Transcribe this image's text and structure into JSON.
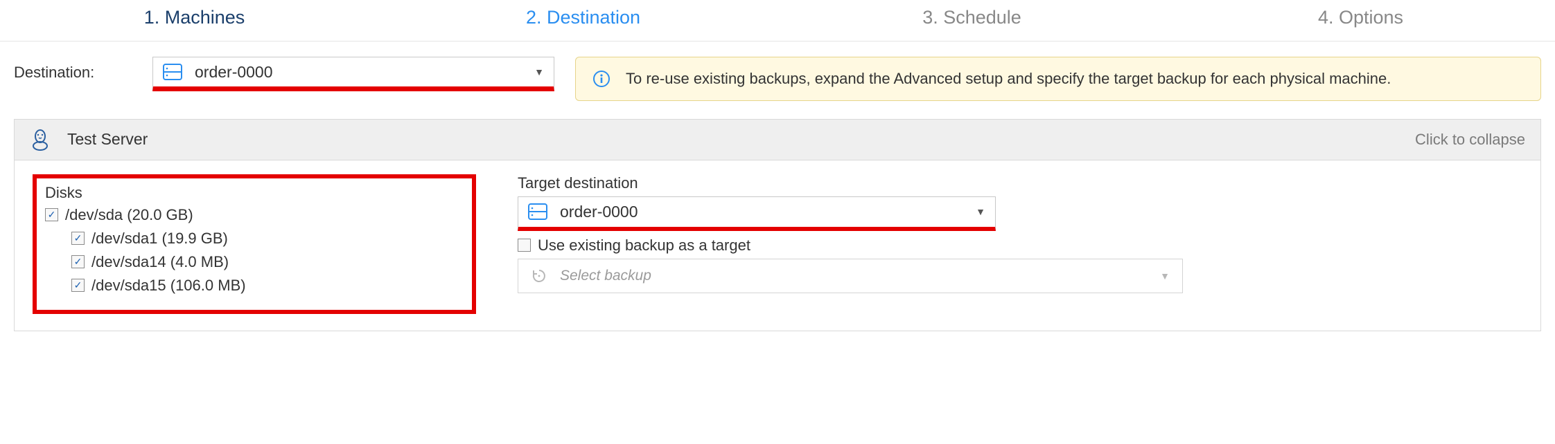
{
  "steps": {
    "s1": "1. Machines",
    "s2": "2. Destination",
    "s3": "3. Schedule",
    "s4": "4. Options"
  },
  "destination": {
    "label": "Destination:",
    "value": "order-0000"
  },
  "info": {
    "text": "To re-use existing backups, expand the Advanced setup and specify the target backup for each physical machine."
  },
  "server": {
    "name": "Test Server",
    "collapse_label": "Click to collapse"
  },
  "disks": {
    "title": "Disks",
    "root": "/dev/sda (20.0 GB)",
    "p1": "/dev/sda1 (19.9 GB)",
    "p2": "/dev/sda14 (4.0 MB)",
    "p3": "/dev/sda15 (106.0 MB)"
  },
  "target": {
    "title": "Target destination",
    "value": "order-0000",
    "use_existing_label": "Use existing backup as a target",
    "select_backup_placeholder": "Select backup"
  }
}
